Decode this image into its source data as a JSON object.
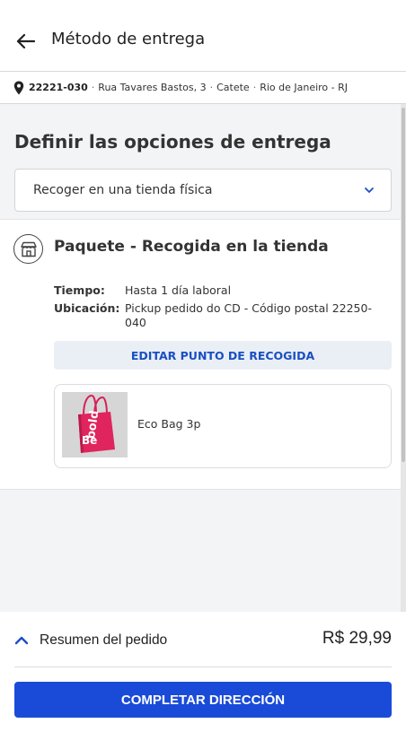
{
  "header": {
    "title": "Método de entrega",
    "back_icon": "arrow-left-icon"
  },
  "address": {
    "zip": "22221-030",
    "street": "Rua Tavares Bastos, 3",
    "neighborhood": "Catete",
    "city": "Rio de Janeiro - RJ",
    "icon": "map-pin-icon"
  },
  "delivery": {
    "section_title": "Definir las opciones de entrega",
    "selected_option": "Recoger en una tienda física"
  },
  "package": {
    "title": "Paquete - Recogida en la tienda",
    "icon": "store-icon",
    "time_label": "Tiempo:",
    "time_value": "Hasta 1 día laboral",
    "location_label": "Ubicación:",
    "location_value": "Pickup pedido do CD - Código postal 22250-040",
    "edit_button": "EDITAR PUNTO DE RECOGIDA",
    "product": {
      "name": "Eco Bag 3p",
      "image_text": "Be bold"
    }
  },
  "footer": {
    "summary_label": "Resumen del pedido",
    "total": "R$ 29,99",
    "cta": "COMPLETAR DIRECCIÓN"
  },
  "colors": {
    "primary": "#1a4bd8",
    "link": "#1a4fc4",
    "bag": "#e0245e"
  }
}
